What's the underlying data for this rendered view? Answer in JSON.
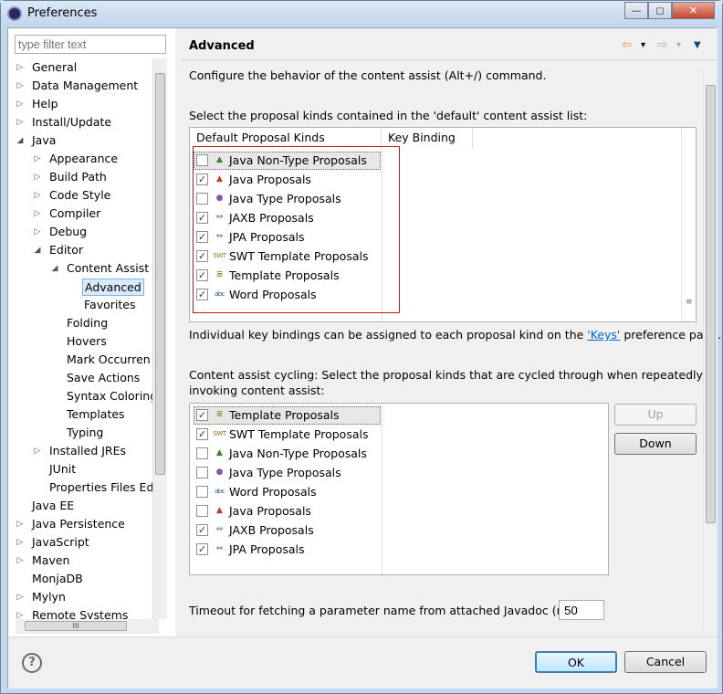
{
  "window": {
    "title": "Preferences",
    "min_label": "—",
    "max_label": "◻",
    "close_label": "✕"
  },
  "filter": {
    "placeholder": "type filter text"
  },
  "tree": [
    {
      "label": "General",
      "depth": 0,
      "twisty": "▷"
    },
    {
      "label": "Data Management",
      "depth": 0,
      "twisty": "▷"
    },
    {
      "label": "Help",
      "depth": 0,
      "twisty": "▷"
    },
    {
      "label": "Install/Update",
      "depth": 0,
      "twisty": "▷"
    },
    {
      "label": "Java",
      "depth": 0,
      "twisty": "◢"
    },
    {
      "label": "Appearance",
      "depth": 1,
      "twisty": "▷"
    },
    {
      "label": "Build Path",
      "depth": 1,
      "twisty": "▷"
    },
    {
      "label": "Code Style",
      "depth": 1,
      "twisty": "▷"
    },
    {
      "label": "Compiler",
      "depth": 1,
      "twisty": "▷"
    },
    {
      "label": "Debug",
      "depth": 1,
      "twisty": "▷"
    },
    {
      "label": "Editor",
      "depth": 1,
      "twisty": "◢"
    },
    {
      "label": "Content Assist",
      "depth": 2,
      "twisty": "◢"
    },
    {
      "label": "Advanced",
      "depth": 3,
      "twisty": "",
      "selected": true
    },
    {
      "label": "Favorites",
      "depth": 3,
      "twisty": ""
    },
    {
      "label": "Folding",
      "depth": 2,
      "twisty": ""
    },
    {
      "label": "Hovers",
      "depth": 2,
      "twisty": ""
    },
    {
      "label": "Mark Occurren",
      "depth": 2,
      "twisty": ""
    },
    {
      "label": "Save Actions",
      "depth": 2,
      "twisty": ""
    },
    {
      "label": "Syntax Coloring",
      "depth": 2,
      "twisty": ""
    },
    {
      "label": "Templates",
      "depth": 2,
      "twisty": ""
    },
    {
      "label": "Typing",
      "depth": 2,
      "twisty": ""
    },
    {
      "label": "Installed JREs",
      "depth": 1,
      "twisty": "▷"
    },
    {
      "label": "JUnit",
      "depth": 1,
      "twisty": ""
    },
    {
      "label": "Properties Files Ed",
      "depth": 1,
      "twisty": ""
    },
    {
      "label": "Java EE",
      "depth": 0,
      "twisty": ""
    },
    {
      "label": "Java Persistence",
      "depth": 0,
      "twisty": "▷"
    },
    {
      "label": "JavaScript",
      "depth": 0,
      "twisty": "▷"
    },
    {
      "label": "Maven",
      "depth": 0,
      "twisty": "▷"
    },
    {
      "label": "MonjaDB",
      "depth": 0,
      "twisty": ""
    },
    {
      "label": "Mylyn",
      "depth": 0,
      "twisty": "▷"
    },
    {
      "label": "Remote Systems",
      "depth": 0,
      "twisty": "▷"
    }
  ],
  "hscroll_grip": "III",
  "page": {
    "title": "Advanced",
    "nav_back": "⇦",
    "nav_back_menu": "▾",
    "nav_forward": "⇨",
    "nav_forward_menu": "▾",
    "view_menu": "▼",
    "description": "Configure the behavior of the content assist (Alt+/) command.",
    "default_list_label": "Select the proposal kinds contained in the 'default' content assist list:",
    "col_kinds": "Default Proposal Kinds",
    "col_binding": "Key Binding",
    "keys_note_prefix": "Individual key bindings can be assigned to each proposal kind on the ",
    "keys_link": "'Keys'",
    "keys_note_suffix": " preference page.",
    "cycling_label_1": "Content assist cycling: Select the proposal kinds that are cycled through when repeatedly",
    "cycling_label_2": "invoking content assist:",
    "up_label": "Up",
    "down_label": "Down",
    "timeout_label": "Timeout for fetching a parameter name from attached Javadoc (ms):",
    "timeout_value": "50"
  },
  "default_kinds": [
    {
      "label": "Java Non-Type Proposals",
      "checked": false,
      "icon": "java-non-type-icon",
      "glyph": "▲",
      "color": "#3a7d2c"
    },
    {
      "label": "Java Proposals",
      "checked": true,
      "icon": "java-proposals-icon",
      "glyph": "▲",
      "color": "#c0392b"
    },
    {
      "label": "Java Type Proposals",
      "checked": false,
      "icon": "java-type-icon",
      "glyph": "●",
      "color": "#7d5ba6"
    },
    {
      "label": "JAXB Proposals",
      "checked": true,
      "icon": "jaxb-icon",
      "glyph": "⇔",
      "color": "#3a6ea5"
    },
    {
      "label": "JPA Proposals",
      "checked": true,
      "icon": "jpa-icon",
      "glyph": "⇔",
      "color": "#3a6ea5"
    },
    {
      "label": "SWT Template Proposals",
      "checked": true,
      "icon": "swt-template-icon",
      "glyph": "SWT",
      "color": "#8a6d1e"
    },
    {
      "label": "Template Proposals",
      "checked": true,
      "icon": "template-icon",
      "glyph": "≣",
      "color": "#8a6d1e"
    },
    {
      "label": "Word Proposals",
      "checked": true,
      "icon": "word-icon",
      "glyph": "abc",
      "color": "#1f4e8c"
    }
  ],
  "cycling_kinds": [
    {
      "label": "Template Proposals",
      "checked": true,
      "icon": "template-icon",
      "glyph": "≣",
      "color": "#8a6d1e"
    },
    {
      "label": "SWT Template Proposals",
      "checked": true,
      "icon": "swt-template-icon",
      "glyph": "SWT",
      "color": "#8a6d1e"
    },
    {
      "label": "Java Non-Type Proposals",
      "checked": false,
      "icon": "java-non-type-icon",
      "glyph": "▲",
      "color": "#3a7d2c"
    },
    {
      "label": "Java Type Proposals",
      "checked": false,
      "icon": "java-type-icon",
      "glyph": "●",
      "color": "#7d5ba6"
    },
    {
      "label": "Word Proposals",
      "checked": false,
      "icon": "word-icon",
      "glyph": "abc",
      "color": "#1f4e8c"
    },
    {
      "label": "Java Proposals",
      "checked": false,
      "icon": "java-proposals-icon",
      "glyph": "▲",
      "color": "#c0392b"
    },
    {
      "label": "JAXB Proposals",
      "checked": true,
      "icon": "jaxb-icon",
      "glyph": "⇔",
      "color": "#3a6ea5"
    },
    {
      "label": "JPA Proposals",
      "checked": true,
      "icon": "jpa-icon",
      "glyph": "⇔",
      "color": "#3a6ea5"
    }
  ],
  "check_glyph": "✓",
  "footer": {
    "help_label": "?",
    "ok_label": "OK",
    "cancel_label": "Cancel"
  },
  "colors": {
    "highlight_box": "#c11a1a",
    "selection": "#d9ebfb",
    "link": "#0066cc"
  }
}
